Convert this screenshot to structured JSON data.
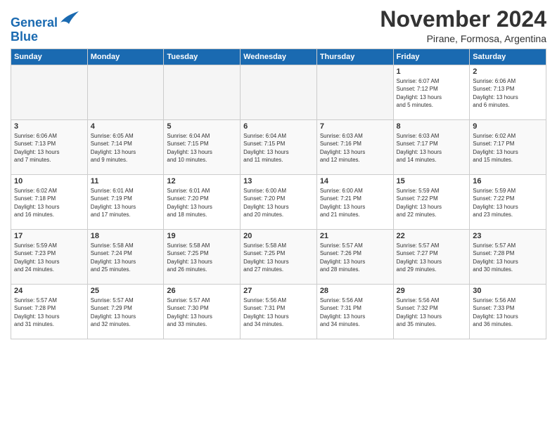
{
  "header": {
    "logo_general": "General",
    "logo_blue": "Blue",
    "title": "November 2024",
    "location": "Pirane, Formosa, Argentina"
  },
  "columns": [
    "Sunday",
    "Monday",
    "Tuesday",
    "Wednesday",
    "Thursday",
    "Friday",
    "Saturday"
  ],
  "weeks": [
    {
      "days": [
        {
          "num": "",
          "info": "",
          "empty": true
        },
        {
          "num": "",
          "info": "",
          "empty": true
        },
        {
          "num": "",
          "info": "",
          "empty": true
        },
        {
          "num": "",
          "info": "",
          "empty": true
        },
        {
          "num": "",
          "info": "",
          "empty": true
        },
        {
          "num": "1",
          "info": "Sunrise: 6:07 AM\nSunset: 7:12 PM\nDaylight: 13 hours\nand 5 minutes.",
          "empty": false
        },
        {
          "num": "2",
          "info": "Sunrise: 6:06 AM\nSunset: 7:13 PM\nDaylight: 13 hours\nand 6 minutes.",
          "empty": false
        }
      ]
    },
    {
      "days": [
        {
          "num": "3",
          "info": "Sunrise: 6:06 AM\nSunset: 7:13 PM\nDaylight: 13 hours\nand 7 minutes.",
          "empty": false
        },
        {
          "num": "4",
          "info": "Sunrise: 6:05 AM\nSunset: 7:14 PM\nDaylight: 13 hours\nand 9 minutes.",
          "empty": false
        },
        {
          "num": "5",
          "info": "Sunrise: 6:04 AM\nSunset: 7:15 PM\nDaylight: 13 hours\nand 10 minutes.",
          "empty": false
        },
        {
          "num": "6",
          "info": "Sunrise: 6:04 AM\nSunset: 7:15 PM\nDaylight: 13 hours\nand 11 minutes.",
          "empty": false
        },
        {
          "num": "7",
          "info": "Sunrise: 6:03 AM\nSunset: 7:16 PM\nDaylight: 13 hours\nand 12 minutes.",
          "empty": false
        },
        {
          "num": "8",
          "info": "Sunrise: 6:03 AM\nSunset: 7:17 PM\nDaylight: 13 hours\nand 14 minutes.",
          "empty": false
        },
        {
          "num": "9",
          "info": "Sunrise: 6:02 AM\nSunset: 7:17 PM\nDaylight: 13 hours\nand 15 minutes.",
          "empty": false
        }
      ]
    },
    {
      "days": [
        {
          "num": "10",
          "info": "Sunrise: 6:02 AM\nSunset: 7:18 PM\nDaylight: 13 hours\nand 16 minutes.",
          "empty": false
        },
        {
          "num": "11",
          "info": "Sunrise: 6:01 AM\nSunset: 7:19 PM\nDaylight: 13 hours\nand 17 minutes.",
          "empty": false
        },
        {
          "num": "12",
          "info": "Sunrise: 6:01 AM\nSunset: 7:20 PM\nDaylight: 13 hours\nand 18 minutes.",
          "empty": false
        },
        {
          "num": "13",
          "info": "Sunrise: 6:00 AM\nSunset: 7:20 PM\nDaylight: 13 hours\nand 20 minutes.",
          "empty": false
        },
        {
          "num": "14",
          "info": "Sunrise: 6:00 AM\nSunset: 7:21 PM\nDaylight: 13 hours\nand 21 minutes.",
          "empty": false
        },
        {
          "num": "15",
          "info": "Sunrise: 5:59 AM\nSunset: 7:22 PM\nDaylight: 13 hours\nand 22 minutes.",
          "empty": false
        },
        {
          "num": "16",
          "info": "Sunrise: 5:59 AM\nSunset: 7:22 PM\nDaylight: 13 hours\nand 23 minutes.",
          "empty": false
        }
      ]
    },
    {
      "days": [
        {
          "num": "17",
          "info": "Sunrise: 5:59 AM\nSunset: 7:23 PM\nDaylight: 13 hours\nand 24 minutes.",
          "empty": false
        },
        {
          "num": "18",
          "info": "Sunrise: 5:58 AM\nSunset: 7:24 PM\nDaylight: 13 hours\nand 25 minutes.",
          "empty": false
        },
        {
          "num": "19",
          "info": "Sunrise: 5:58 AM\nSunset: 7:25 PM\nDaylight: 13 hours\nand 26 minutes.",
          "empty": false
        },
        {
          "num": "20",
          "info": "Sunrise: 5:58 AM\nSunset: 7:25 PM\nDaylight: 13 hours\nand 27 minutes.",
          "empty": false
        },
        {
          "num": "21",
          "info": "Sunrise: 5:57 AM\nSunset: 7:26 PM\nDaylight: 13 hours\nand 28 minutes.",
          "empty": false
        },
        {
          "num": "22",
          "info": "Sunrise: 5:57 AM\nSunset: 7:27 PM\nDaylight: 13 hours\nand 29 minutes.",
          "empty": false
        },
        {
          "num": "23",
          "info": "Sunrise: 5:57 AM\nSunset: 7:28 PM\nDaylight: 13 hours\nand 30 minutes.",
          "empty": false
        }
      ]
    },
    {
      "days": [
        {
          "num": "24",
          "info": "Sunrise: 5:57 AM\nSunset: 7:28 PM\nDaylight: 13 hours\nand 31 minutes.",
          "empty": false
        },
        {
          "num": "25",
          "info": "Sunrise: 5:57 AM\nSunset: 7:29 PM\nDaylight: 13 hours\nand 32 minutes.",
          "empty": false
        },
        {
          "num": "26",
          "info": "Sunrise: 5:57 AM\nSunset: 7:30 PM\nDaylight: 13 hours\nand 33 minutes.",
          "empty": false
        },
        {
          "num": "27",
          "info": "Sunrise: 5:56 AM\nSunset: 7:31 PM\nDaylight: 13 hours\nand 34 minutes.",
          "empty": false
        },
        {
          "num": "28",
          "info": "Sunrise: 5:56 AM\nSunset: 7:31 PM\nDaylight: 13 hours\nand 34 minutes.",
          "empty": false
        },
        {
          "num": "29",
          "info": "Sunrise: 5:56 AM\nSunset: 7:32 PM\nDaylight: 13 hours\nand 35 minutes.",
          "empty": false
        },
        {
          "num": "30",
          "info": "Sunrise: 5:56 AM\nSunset: 7:33 PM\nDaylight: 13 hours\nand 36 minutes.",
          "empty": false
        }
      ]
    }
  ]
}
